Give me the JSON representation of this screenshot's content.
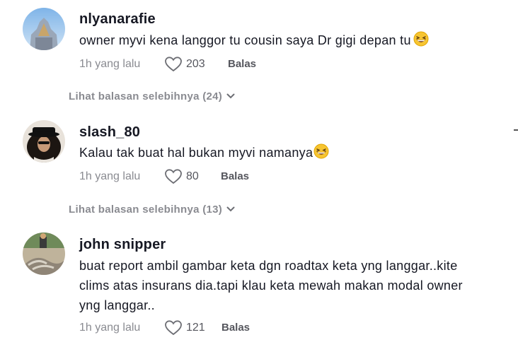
{
  "comments": [
    {
      "username": "nlyanarafie",
      "text": "owner myvi kena langgor tu cousin saya Dr gigi depan tu",
      "emoji": "grinning-squinting-face",
      "time": "1h yang lalu",
      "likes": "203",
      "reply_label": "Balas",
      "more_replies": "Lihat balasan selebihnya (24)"
    },
    {
      "username": "slash_80",
      "text": "Kalau tak buat hal bukan myvi namanya",
      "emoji": "grinning-squinting-face",
      "time": "1h yang lalu",
      "likes": "80",
      "reply_label": "Balas",
      "more_replies": "Lihat balasan selebihnya (13)"
    },
    {
      "username": "john snipper",
      "text_lines": [
        "buat report ambil gambar keta dgn roadtax keta yng langgar..kite",
        "clims atas insurans dia.tapi klau keta mewah makan modal owner",
        "yng langgar.."
      ],
      "time": "1h yang lalu",
      "likes": "121",
      "reply_label": "Balas"
    }
  ],
  "colors": {
    "primary_text": "#161823",
    "secondary_text": "#8a8b91",
    "background": "#ffffff"
  }
}
